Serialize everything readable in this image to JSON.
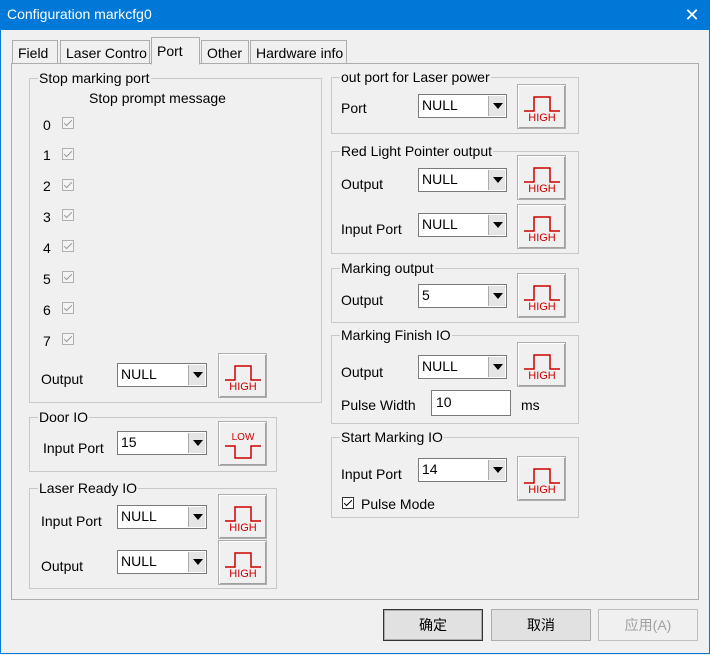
{
  "window": {
    "title": "Configuration markcfg0",
    "close": "✕"
  },
  "tabs": [
    {
      "label": "Field"
    },
    {
      "label": "Laser Contro"
    },
    {
      "label": "Port"
    },
    {
      "label": "Other"
    },
    {
      "label": "Hardware info"
    }
  ],
  "stop_marking": {
    "title": "Stop marking port",
    "prompt": "Stop prompt message",
    "ports": [
      "0",
      "1",
      "2",
      "3",
      "4",
      "5",
      "6",
      "7"
    ],
    "output_label": "Output",
    "output_value": "NULL",
    "level": "HIGH"
  },
  "door_io": {
    "title": "Door IO",
    "input_label": "Input Port",
    "input_value": "15",
    "level": "LOW"
  },
  "laser_ready": {
    "title": "Laser Ready IO",
    "input_label": "Input Port",
    "input_value": "NULL",
    "input_level": "HIGH",
    "output_label": "Output",
    "output_value": "NULL",
    "output_level": "HIGH"
  },
  "laser_power": {
    "title": "out port for Laser power",
    "port_label": "Port",
    "port_value": "NULL",
    "level": "HIGH"
  },
  "red_light": {
    "title": "Red Light Pointer output",
    "output_label": "Output",
    "output_value": "NULL",
    "output_level": "HIGH",
    "input_label": "Input Port",
    "input_value": "NULL",
    "input_level": "HIGH"
  },
  "marking_output": {
    "title": "Marking output",
    "output_label": "Output",
    "output_value": "5",
    "level": "HIGH"
  },
  "marking_finish": {
    "title": "Marking Finish IO",
    "output_label": "Output",
    "output_value": "NULL",
    "level": "HIGH",
    "pulse_label": "Pulse Width",
    "pulse_value": "10",
    "unit": "ms"
  },
  "start_marking": {
    "title": "Start Marking IO",
    "input_label": "Input Port",
    "input_value": "14",
    "level": "HIGH",
    "pulse_mode_label": "Pulse Mode"
  },
  "buttons": {
    "ok": "确定",
    "cancel": "取消",
    "apply": "应用(A)"
  },
  "colors": {
    "titlebar": "#0078d7",
    "signal": "#cc0000"
  }
}
